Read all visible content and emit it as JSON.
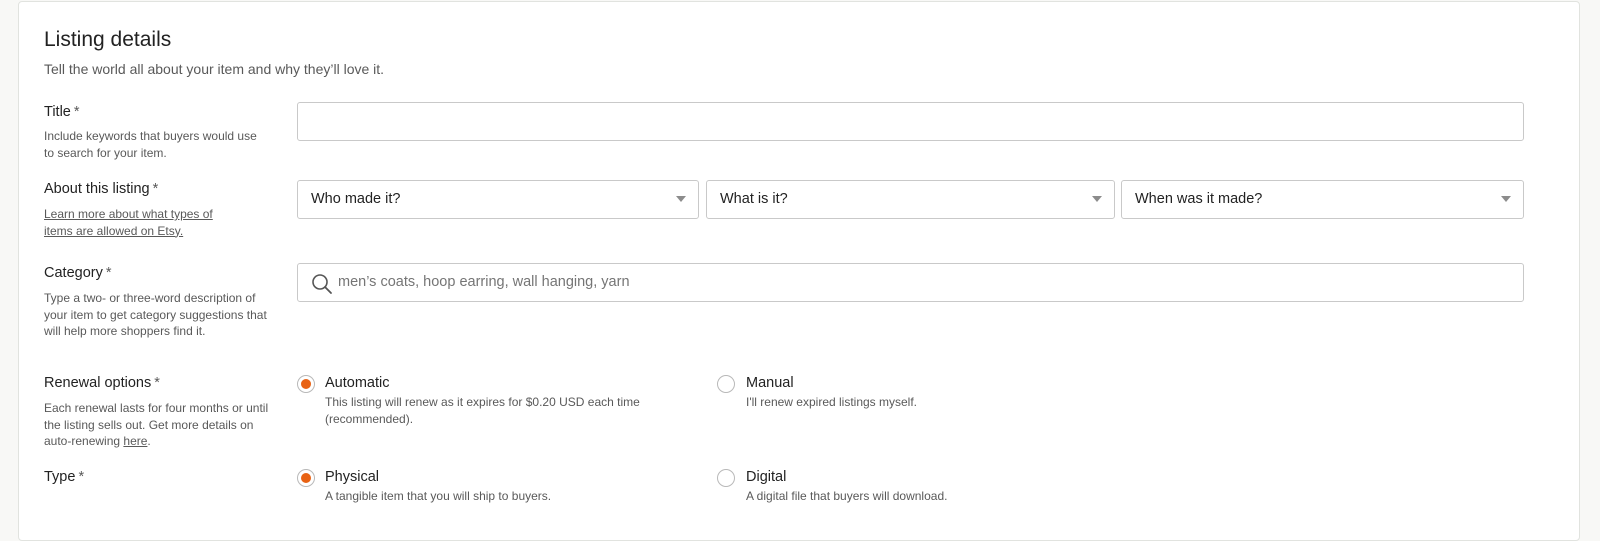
{
  "header": {
    "title": "Listing details",
    "subtitle": "Tell the world all about your item and why they’ll love it."
  },
  "colors": {
    "accent": "#e86214",
    "border": "#c9c9c9",
    "muted_text": "#595959"
  },
  "title_field": {
    "label": "Title",
    "required": "*",
    "help": "Include keywords that buyers would use to search for your item.",
    "value": ""
  },
  "about": {
    "label": "About this listing",
    "required": "*",
    "help_link": "Learn more about what types of items are allowed on Etsy.",
    "selects": [
      {
        "value": "Who made it?"
      },
      {
        "value": "What is it?"
      },
      {
        "value": "When was it made?"
      }
    ]
  },
  "category": {
    "label": "Category",
    "required": "*",
    "help": "Type a two- or three-word description of your item to get category suggestions that will help more shoppers find it.",
    "placeholder": "men’s coats, hoop earring, wall hanging, yarn",
    "icon": "search-icon"
  },
  "renewal": {
    "label": "Renewal options",
    "required": "*",
    "help_prefix": "Each renewal lasts for four months or until the listing sells out. Get more details on auto-renewing ",
    "help_link": "here",
    "help_suffix": ".",
    "options": [
      {
        "label": "Automatic",
        "desc": "This listing will renew as it expires for $0.20 USD each time (recommended).",
        "selected": true
      },
      {
        "label": "Manual",
        "desc": "I'll renew expired listings myself.",
        "selected": false
      }
    ]
  },
  "type": {
    "label": "Type",
    "required": "*",
    "options": [
      {
        "label": "Physical",
        "desc": "A tangible item that you will ship to buyers.",
        "selected": true
      },
      {
        "label": "Digital",
        "desc": "A digital file that buyers will download.",
        "selected": false
      }
    ]
  }
}
